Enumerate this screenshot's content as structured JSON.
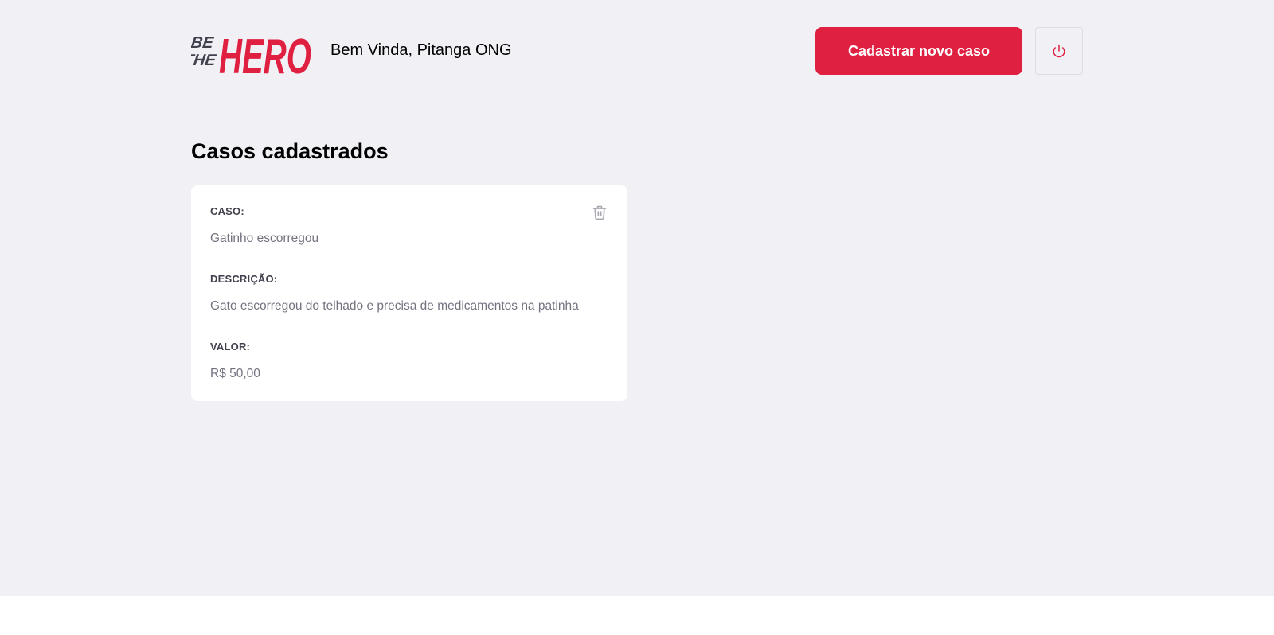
{
  "header": {
    "logo": {
      "line1": "BE",
      "line2": "THE",
      "word": "HERO"
    },
    "greeting": "Bem Vinda, Pitanga ONG",
    "new_case_label": "Cadastrar novo caso",
    "logout_icon": "power-icon"
  },
  "main": {
    "title": "Casos cadastrados",
    "cases": [
      {
        "case_label": "CASO:",
        "case_value": "Gatinho escorregou",
        "description_label": "DESCRIÇÃO:",
        "description_value": "Gato escorregou do telhado e precisa de medicamentos na patinha",
        "value_label": "VALOR:",
        "value_value": "R$ 50,00",
        "delete_icon": "trash-icon"
      }
    ]
  },
  "colors": {
    "accent": "#e02041",
    "background": "#f0f0f5",
    "card": "#ffffff",
    "label": "#41414d",
    "value": "#737380",
    "logo_dark": "#41414d",
    "icon_gray": "#a8a8b3"
  }
}
